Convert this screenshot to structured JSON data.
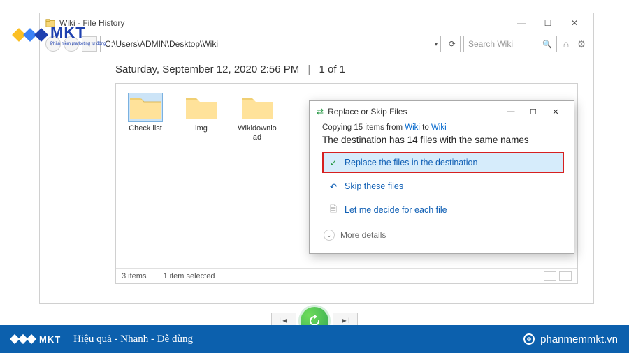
{
  "logo": {
    "text": "MKT",
    "sub": "Phần mềm marketing tự động"
  },
  "window": {
    "title": "Wiki - File History",
    "nav": {
      "back": "←",
      "fwd": "→",
      "up": "↑"
    },
    "address": "C:\\Users\\ADMIN\\Desktop\\Wiki",
    "search_placeholder": "Search Wiki",
    "date_line": "Saturday, September 12, 2020 2:56 PM",
    "count": "1 of 1",
    "folders": [
      {
        "name": "Check list",
        "selected": true
      },
      {
        "name": "img",
        "selected": false
      },
      {
        "name": "Wikidownload",
        "selected": false
      }
    ],
    "status": {
      "items": "3 items",
      "selected": "1 item selected"
    }
  },
  "dialog": {
    "title": "Replace or Skip Files",
    "copy_prefix": "Copying 15 items from ",
    "copy_src": "Wiki",
    "copy_mid": " to ",
    "copy_dst": "Wiki",
    "headline": "The destination has 14 files with the same names",
    "opt_replace": "Replace the files in the destination",
    "opt_skip": "Skip these files",
    "opt_decide": "Let me decide for each file",
    "more": "More details"
  },
  "footer": {
    "logo": "MKT",
    "slogan": "Hiệu quả - Nhanh  - Dễ dùng",
    "site": "phanmemmkt.vn"
  }
}
